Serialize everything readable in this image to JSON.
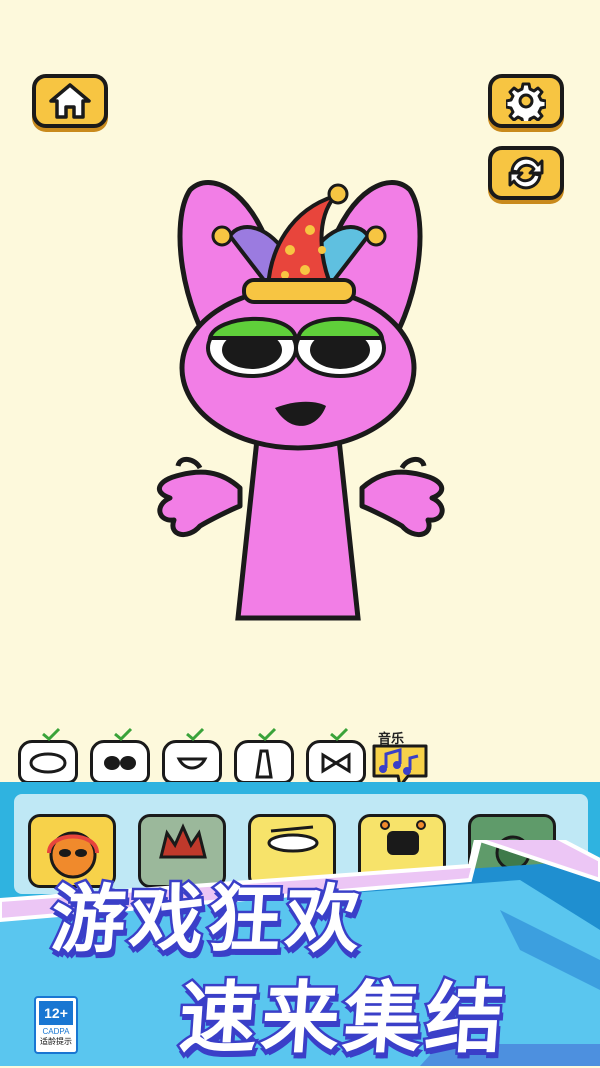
{
  "toolbar": {
    "home_icon": "home-icon",
    "settings_icon": "gear-icon",
    "refresh_icon": "refresh-icon"
  },
  "character": {
    "body_color": "#f27ee6",
    "eyelid_color": "#5fcf3a",
    "hat_colors": [
      "#e8453c",
      "#9b7be0",
      "#5fc0e0",
      "#f7c542"
    ]
  },
  "categories": {
    "items": [
      {
        "icon": "head-shape-icon",
        "checked": true
      },
      {
        "icon": "eyes-icon",
        "checked": true
      },
      {
        "icon": "mouth-icon",
        "checked": true
      },
      {
        "icon": "body-icon",
        "checked": true
      },
      {
        "icon": "bowtie-icon",
        "checked": true
      },
      {
        "icon": "music-notes-icon",
        "label": "音乐"
      }
    ]
  },
  "promo": {
    "line1": "游戏狂欢",
    "line2": "速来集结"
  },
  "age_rating": {
    "number": "12+",
    "org": "CADPA",
    "tip": "适龄提示"
  },
  "colors": {
    "background": "#fdf9dc",
    "button": "#f7c542",
    "panel": "#2fb3e0",
    "promo_stroke": "#3a3fc8"
  }
}
